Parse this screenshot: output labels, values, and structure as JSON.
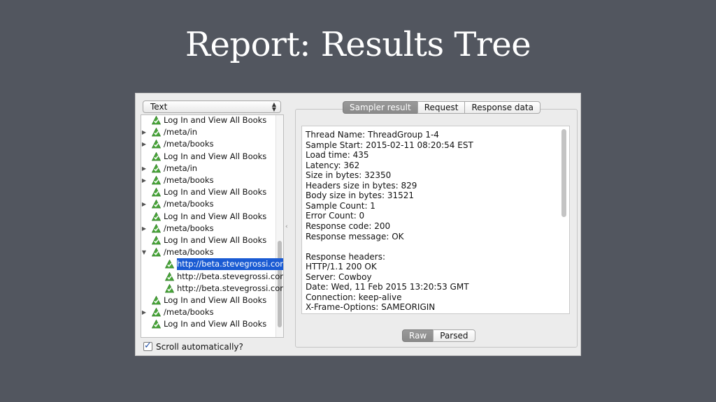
{
  "slide": {
    "title": "Report: Results Tree"
  },
  "left_panel": {
    "renderer_select": {
      "value": "Text"
    },
    "tree": [
      {
        "label": "Log In and View All Books",
        "expander": "none",
        "indent": 0
      },
      {
        "label": "/meta/in",
        "expander": "collapsed",
        "indent": 0
      },
      {
        "label": "/meta/books",
        "expander": "collapsed",
        "indent": 0
      },
      {
        "label": "Log In and View All Books",
        "expander": "none",
        "indent": 0
      },
      {
        "label": "/meta/in",
        "expander": "collapsed",
        "indent": 0
      },
      {
        "label": "/meta/books",
        "expander": "collapsed",
        "indent": 0
      },
      {
        "label": "Log In and View All Books",
        "expander": "none",
        "indent": 0
      },
      {
        "label": "/meta/books",
        "expander": "collapsed",
        "indent": 0
      },
      {
        "label": "Log In and View All Books",
        "expander": "none",
        "indent": 0
      },
      {
        "label": "/meta/books",
        "expander": "collapsed",
        "indent": 0
      },
      {
        "label": "Log In and View All Books",
        "expander": "none",
        "indent": 0
      },
      {
        "label": "/meta/books",
        "expander": "expanded",
        "indent": 0
      },
      {
        "label": "http://beta.stevegrossi.com",
        "expander": "none",
        "indent": 1,
        "selected": true
      },
      {
        "label": "http://beta.stevegrossi.com",
        "expander": "none",
        "indent": 1
      },
      {
        "label": "http://beta.stevegrossi.com",
        "expander": "none",
        "indent": 1
      },
      {
        "label": "Log In and View All Books",
        "expander": "none",
        "indent": 0
      },
      {
        "label": "/meta/books",
        "expander": "collapsed",
        "indent": 0
      },
      {
        "label": "Log In and View All Books",
        "expander": "none",
        "indent": 0
      }
    ],
    "scroll_checkbox": {
      "label": "Scroll automatically?",
      "checked": true
    }
  },
  "right_panel": {
    "tabs": [
      {
        "label": "Sampler result",
        "active": true
      },
      {
        "label": "Request",
        "active": false
      },
      {
        "label": "Response data",
        "active": false
      }
    ],
    "result_lines": [
      "Thread Name: ThreadGroup 1-4",
      "Sample Start: 2015-02-11 08:20:54 EST",
      "Load time: 435",
      "Latency: 362",
      "Size in bytes: 32350",
      "Headers size in bytes: 829",
      "Body size in bytes: 31521",
      "Sample Count: 1",
      "Error Count: 0",
      "Response code: 200",
      "Response message: OK",
      "",
      "Response headers:",
      "HTTP/1.1 200 OK",
      "Server: Cowboy",
      "Date: Wed, 11 Feb 2015 13:20:53 GMT",
      "Connection: keep-alive",
      "X-Frame-Options: SAMEORIGIN"
    ],
    "view_buttons": [
      {
        "label": "Raw",
        "active": true
      },
      {
        "label": "Parsed",
        "active": false
      }
    ]
  },
  "icons": {
    "tree_node": "success-triangle-icon",
    "checkbox": "checkmark-icon"
  },
  "colors": {
    "background": "#52565f",
    "selection": "#1a5bd3",
    "success_icon": "#4aa83a"
  }
}
